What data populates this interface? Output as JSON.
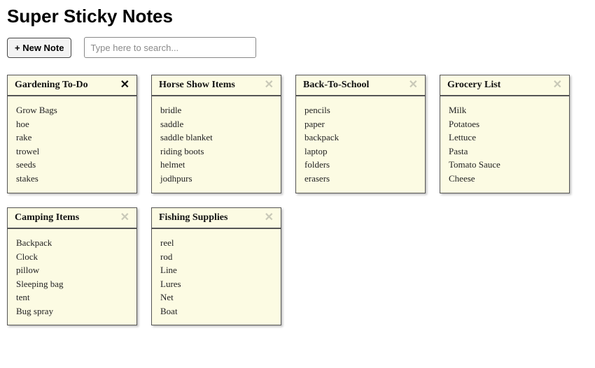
{
  "app": {
    "title": "Super Sticky Notes"
  },
  "toolbar": {
    "new_note_label": "+ New Note",
    "search_placeholder": "Type here to search..."
  },
  "notes": [
    {
      "title": "Gardening To-Do",
      "close_active": true,
      "scroll": true,
      "items": [
        "Grow Bags",
        "hoe",
        "rake",
        "trowel",
        "seeds",
        "stakes"
      ]
    },
    {
      "title": "horse Show items",
      "close_active": false,
      "scroll": false,
      "items": [
        "bridle",
        "saddle",
        "saddle blanket",
        "riding boots",
        "helmet",
        "jodhpurs"
      ]
    },
    {
      "title": "back-to-school",
      "close_active": false,
      "scroll": false,
      "items": [
        "pencils",
        "paper",
        "backpack",
        "laptop",
        "folders",
        "erasers"
      ]
    },
    {
      "title": "Grocery List",
      "close_active": false,
      "scroll": false,
      "items": [
        "Milk",
        "Potatoes",
        "Lettuce",
        "Pasta",
        "Tomato Sauce",
        "Cheese"
      ]
    },
    {
      "title": "Camping Items",
      "close_active": false,
      "scroll": false,
      "items": [
        "Backpack",
        "Clock",
        "pillow",
        "Sleeping bag",
        "tent",
        "Bug spray"
      ]
    },
    {
      "title": "Fishing Supplies",
      "close_active": false,
      "scroll": false,
      "items": [
        "reel",
        "rod",
        "Line",
        "Lures",
        "Net",
        "Boat"
      ]
    }
  ]
}
